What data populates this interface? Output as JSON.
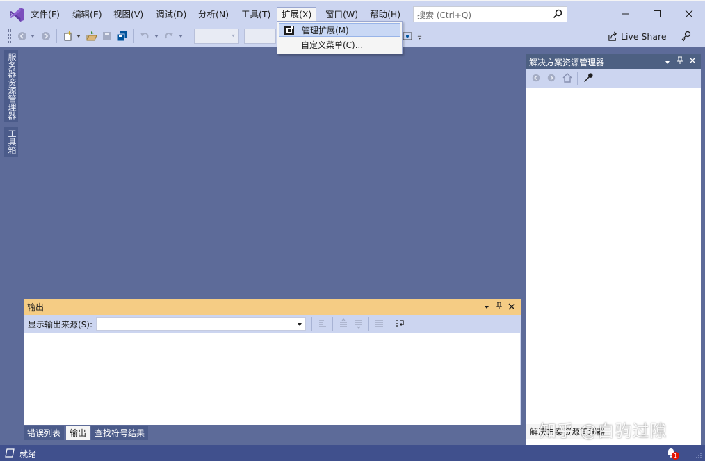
{
  "menu": {
    "items": [
      {
        "label": "文件(F)"
      },
      {
        "label": "编辑(E)"
      },
      {
        "label": "视图(V)"
      },
      {
        "label": "调试(D)"
      },
      {
        "label": "分析(N)"
      },
      {
        "label": "工具(T)"
      },
      {
        "label": "扩展(X)"
      },
      {
        "label": "窗口(W)"
      },
      {
        "label": "帮助(H)"
      }
    ],
    "search_placeholder": "搜索 (Ctrl+Q)"
  },
  "extensions_menu": {
    "items": [
      {
        "label": "管理扩展(M)",
        "icon": "manage-extensions-icon"
      },
      {
        "label": "自定义菜单(C)...",
        "icon": ""
      }
    ]
  },
  "toolbar": {
    "live_share_label": "Live Share"
  },
  "side_tabs": {
    "server_explorer": "服务器资源管理器",
    "toolbox": "工具箱"
  },
  "output_panel": {
    "title": "输出",
    "source_label": "显示输出来源(S):",
    "source_value": "",
    "tabs": [
      {
        "label": "错误列表",
        "active": false
      },
      {
        "label": "输出",
        "active": true
      },
      {
        "label": "查找符号结果",
        "active": false
      }
    ]
  },
  "solution_explorer": {
    "title": "解决方案资源管理器",
    "bottom_tab": "解决方案资源管理器"
  },
  "status_bar": {
    "text": "就绪",
    "notification_count": "1"
  },
  "watermark": "知乎 @白驹过隙",
  "colors": {
    "menubar_bg": "#ccd5f0",
    "workspace_bg": "#5d6b99",
    "output_header": "#f5cc84",
    "solution_header": "#4d6082",
    "status_bar": "#40508d",
    "accent_purple": "#68217a"
  }
}
